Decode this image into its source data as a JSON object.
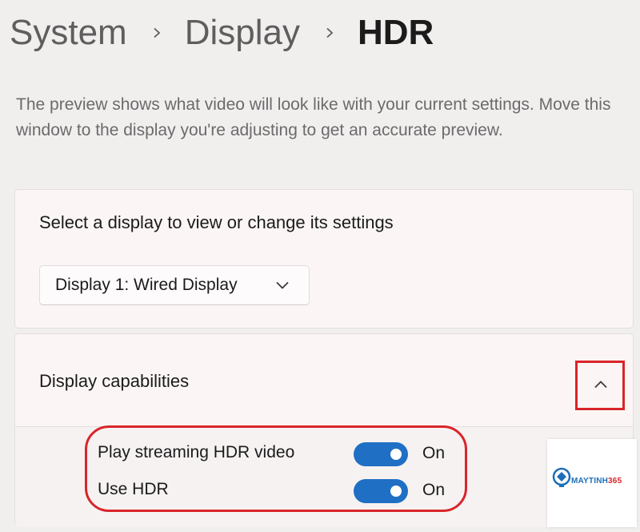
{
  "breadcrumb": {
    "items": [
      "System",
      "Display",
      "HDR"
    ]
  },
  "description": "The preview shows what video will look like with your current settings. Move this window to the display you're adjusting to get an accurate preview.",
  "display_card": {
    "title": "Select a display to view or change its settings",
    "dropdown": {
      "selected": "Display 1: Wired Display",
      "icon": "chevron-down-icon"
    }
  },
  "capabilities_card": {
    "title": "Display capabilities",
    "expand_icon": "chevron-up-icon",
    "settings": [
      {
        "label": "Play streaming HDR video",
        "toggle_on": true,
        "state": "On"
      },
      {
        "label": "Use HDR",
        "toggle_on": true,
        "state": "On"
      }
    ]
  },
  "watermark": {
    "brand": "MAYTINH",
    "brand_number": "365"
  },
  "colors": {
    "accent": "#1f6fc4",
    "highlight": "#d9252a",
    "background": "#f1eeee",
    "card": "#fbf6f5"
  }
}
